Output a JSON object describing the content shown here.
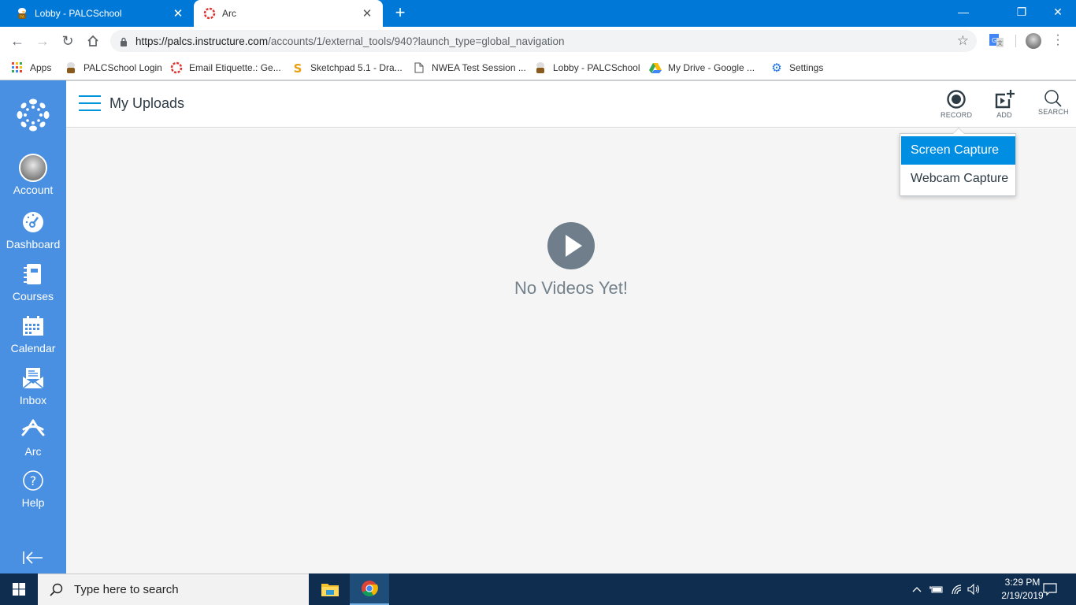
{
  "browser": {
    "tabs": [
      {
        "title": "Lobby - PALCSchool",
        "favicon": "eagle-icon",
        "active": false
      },
      {
        "title": "Arc",
        "favicon": "canvas-ring-icon",
        "active": true
      }
    ],
    "new_tab": "+",
    "window_controls": {
      "minimize": "—",
      "restore": "❐",
      "close": "✕"
    },
    "nav": {
      "back": "←",
      "forward": "→",
      "reload": "↻",
      "home": "⌂"
    },
    "url": {
      "host": "https://palcs.instructure.com",
      "path": "/accounts/1/external_tools/940?launch_type=global_navigation"
    },
    "bookmarks": [
      {
        "label": "Apps",
        "icon": "apps-grid-icon"
      },
      {
        "label": "PALCSchool Login",
        "icon": "eagle-icon"
      },
      {
        "label": "Email Etiquette.: Ge...",
        "icon": "canvas-ring-icon"
      },
      {
        "label": "Sketchpad 5.1 - Dra...",
        "icon": "sketchpad-icon"
      },
      {
        "label": "NWEA Test Session ...",
        "icon": "page-icon"
      },
      {
        "label": "Lobby - PALCSchool",
        "icon": "eagle-icon"
      },
      {
        "label": "My Drive - Google ...",
        "icon": "google-drive-icon"
      },
      {
        "label": "Settings",
        "icon": "gear-icon"
      }
    ]
  },
  "global_nav": {
    "items": [
      {
        "label": "Account",
        "icon": "avatar"
      },
      {
        "label": "Dashboard",
        "icon": "dashboard-icon"
      },
      {
        "label": "Courses",
        "icon": "courses-icon"
      },
      {
        "label": "Calendar",
        "icon": "calendar-icon"
      },
      {
        "label": "Inbox",
        "icon": "inbox-icon"
      },
      {
        "label": "Arc",
        "icon": "arc-icon"
      },
      {
        "label": "Help",
        "icon": "help-icon"
      }
    ],
    "collapse": "collapse-nav"
  },
  "header": {
    "title": "My Uploads",
    "buttons": [
      {
        "label": "RECORD",
        "icon": "record-icon"
      },
      {
        "label": "ADD",
        "icon": "add-video-icon"
      },
      {
        "label": "SEARCH",
        "icon": "search-icon"
      }
    ]
  },
  "record_menu": {
    "items": [
      {
        "label": "Screen Capture",
        "selected": true
      },
      {
        "label": "Webcam Capture",
        "selected": false
      }
    ]
  },
  "empty_state": {
    "message": "No Videos Yet!"
  },
  "taskbar": {
    "search_placeholder": "Type here to search",
    "time": "3:29 PM",
    "date": "2/19/2019"
  },
  "colors": {
    "titlebar": "#0078d7",
    "canvas_nav": "#4a90e2",
    "accent": "#008ee2",
    "taskbar": "#0f2d4e"
  }
}
